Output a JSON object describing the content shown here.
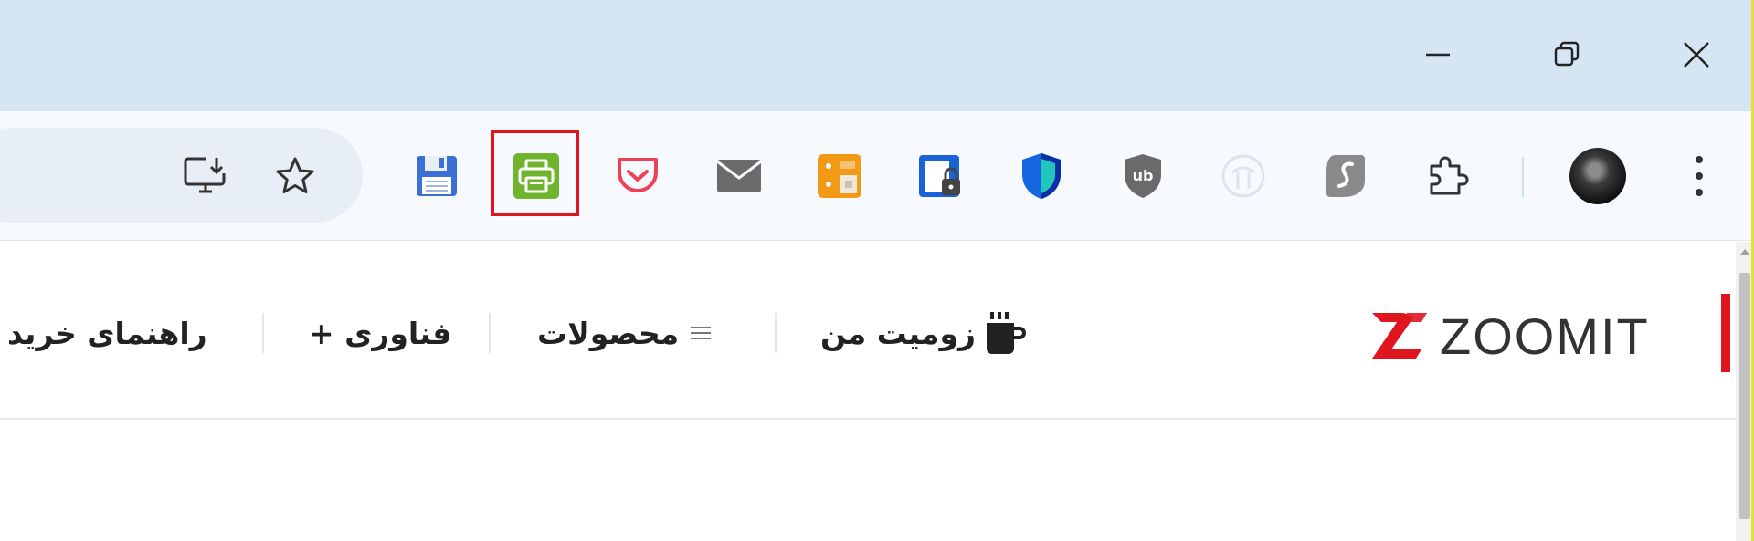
{
  "window_controls": {
    "minimize": "minimize-icon",
    "restore": "restore-icon",
    "close": "close-icon"
  },
  "toolbar": {
    "omnibox_actions": [
      "install-app-icon",
      "bookmark-star-icon"
    ],
    "extensions": [
      {
        "name": "floppy-save-icon"
      },
      {
        "name": "printer-icon",
        "highlighted": true
      },
      {
        "name": "pocket-icon"
      },
      {
        "name": "mail-icon"
      },
      {
        "name": "orange-grid-icon"
      },
      {
        "name": "blue-lock-card-icon"
      },
      {
        "name": "shield-guard-icon"
      },
      {
        "name": "ublock-origin-icon"
      },
      {
        "name": "faint-ghost-icon"
      },
      {
        "name": "surfshark-icon"
      },
      {
        "name": "puzzle-extensions-icon"
      }
    ],
    "profile": "avatar",
    "menu": "more-vert-icon",
    "highlight_color": "#e0161f"
  },
  "site": {
    "logo_text": "ZOOMIT",
    "brand_color": "#e0161f",
    "nav": [
      {
        "label": "زومیت من",
        "icon": "mug-icon"
      },
      {
        "label": "محصولات",
        "icon": "menu-lines-icon"
      },
      {
        "label": "+ فناوری"
      },
      {
        "label": "راهنمای خرید"
      }
    ]
  }
}
